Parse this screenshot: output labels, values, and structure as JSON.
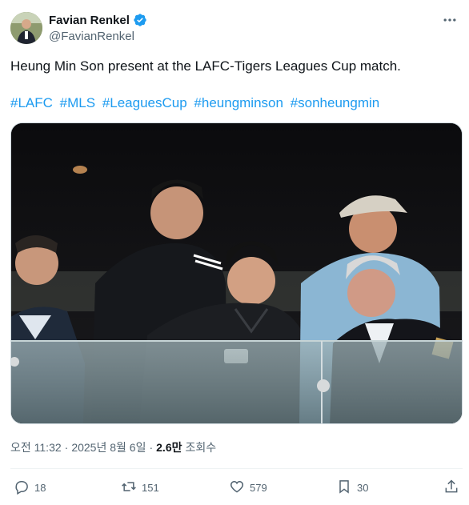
{
  "author": {
    "display_name": "Favian Renkel",
    "handle": "@FavianRenkel",
    "verified": true,
    "verified_color": "#1d9bf0"
  },
  "tweet": {
    "text": "Heung Min Son present at the LAFC-Tigers Leagues Cup match.",
    "hashtags": [
      "#LAFC",
      "#MLS",
      "#LeaguesCup",
      "#heungminson",
      "#sonheungmin"
    ],
    "hashtag_color": "#1d9bf0"
  },
  "meta": {
    "time": "오전 11:32",
    "separator": "·",
    "date": "2025년 8월 6일",
    "views_count": "2.6만",
    "views_label": "조회수"
  },
  "actions": {
    "replies": "18",
    "reposts": "151",
    "likes": "579",
    "bookmarks": "30"
  },
  "icons": [
    "verified-badge-icon",
    "more-icon",
    "reply-icon",
    "repost-icon",
    "like-icon",
    "bookmark-icon",
    "share-icon"
  ]
}
